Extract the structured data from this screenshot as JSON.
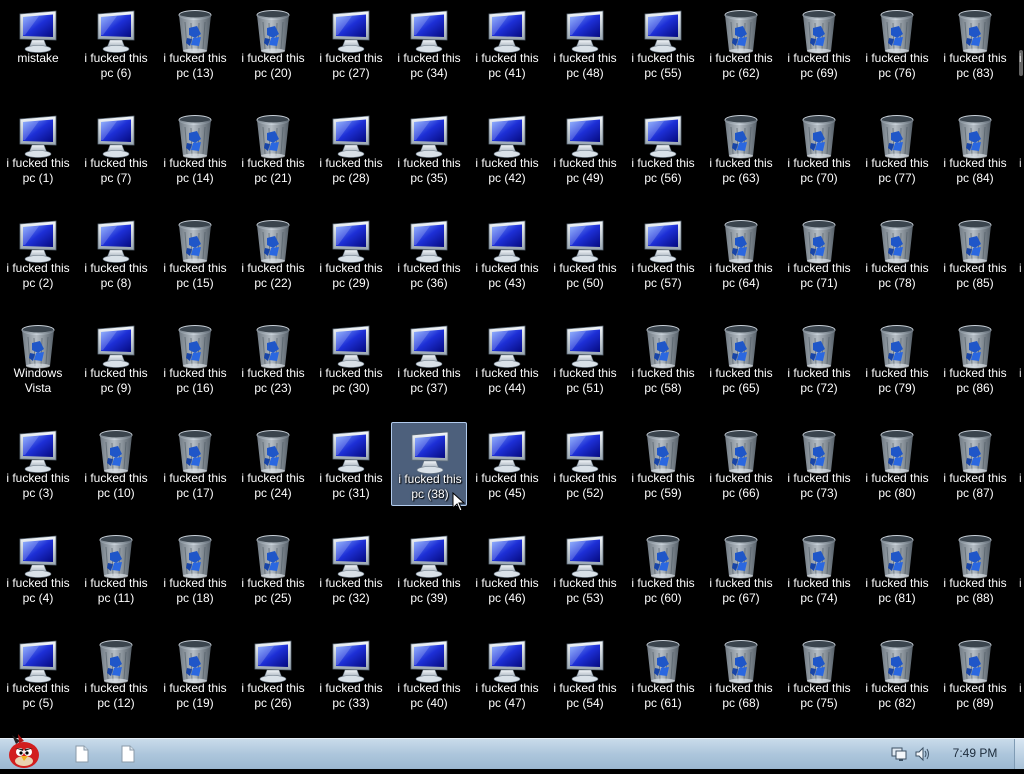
{
  "desktop": {
    "columns": [
      {
        "icons": [
          {
            "label": "mistake",
            "type": "computer"
          },
          {
            "label": "i fucked this pc (1)",
            "type": "computer"
          },
          {
            "label": "i fucked this pc (2)",
            "type": "computer"
          },
          {
            "label": "Windows Vista",
            "type": "recycle"
          },
          {
            "label": "i fucked this pc (3)",
            "type": "computer"
          },
          {
            "label": "i fucked this pc (4)",
            "type": "computer"
          },
          {
            "label": "i fucked this pc (5)",
            "type": "computer"
          }
        ]
      },
      {
        "icons": [
          {
            "label": "i fucked this pc (6)",
            "type": "computer"
          },
          {
            "label": "i fucked this pc (7)",
            "type": "computer"
          },
          {
            "label": "i fucked this pc (8)",
            "type": "computer"
          },
          {
            "label": "i fucked this pc (9)",
            "type": "computer"
          },
          {
            "label": "i fucked this pc (10)",
            "type": "recycle"
          },
          {
            "label": "i fucked this pc (11)",
            "type": "recycle"
          },
          {
            "label": "i fucked this pc (12)",
            "type": "recycle"
          }
        ]
      },
      {
        "icons": [
          {
            "label": "i fucked this pc (13)",
            "type": "recycle"
          },
          {
            "label": "i fucked this pc (14)",
            "type": "recycle"
          },
          {
            "label": "i fucked this pc (15)",
            "type": "recycle"
          },
          {
            "label": "i fucked this pc (16)",
            "type": "recycle"
          },
          {
            "label": "i fucked this pc (17)",
            "type": "recycle"
          },
          {
            "label": "i fucked this pc (18)",
            "type": "recycle"
          },
          {
            "label": "i fucked this pc (19)",
            "type": "recycle"
          }
        ]
      },
      {
        "icons": [
          {
            "label": "i fucked this pc (20)",
            "type": "recycle"
          },
          {
            "label": "i fucked this pc (21)",
            "type": "recycle"
          },
          {
            "label": "i fucked this pc (22)",
            "type": "recycle"
          },
          {
            "label": "i fucked this pc (23)",
            "type": "recycle"
          },
          {
            "label": "i fucked this pc (24)",
            "type": "recycle"
          },
          {
            "label": "i fucked this pc (25)",
            "type": "recycle"
          },
          {
            "label": "i fucked this pc (26)",
            "type": "computer"
          }
        ]
      },
      {
        "icons": [
          {
            "label": "i fucked this pc (27)",
            "type": "computer"
          },
          {
            "label": "i fucked this pc (28)",
            "type": "computer"
          },
          {
            "label": "i fucked this pc (29)",
            "type": "computer"
          },
          {
            "label": "i fucked this pc (30)",
            "type": "computer"
          },
          {
            "label": "i fucked this pc (31)",
            "type": "computer"
          },
          {
            "label": "i fucked this pc (32)",
            "type": "computer"
          },
          {
            "label": "i fucked this pc (33)",
            "type": "computer"
          }
        ]
      },
      {
        "icons": [
          {
            "label": "i fucked this pc (34)",
            "type": "computer"
          },
          {
            "label": "i fucked this pc (35)",
            "type": "computer"
          },
          {
            "label": "i fucked this pc (36)",
            "type": "computer"
          },
          {
            "label": "i fucked this pc (37)",
            "type": "computer"
          },
          {
            "label": "i fucked this pc (38)",
            "type": "computer",
            "selected": true
          },
          {
            "label": "i fucked this pc (39)",
            "type": "computer"
          },
          {
            "label": "i fucked this pc (40)",
            "type": "computer"
          }
        ]
      },
      {
        "icons": [
          {
            "label": "i fucked this pc (41)",
            "type": "computer"
          },
          {
            "label": "i fucked this pc (42)",
            "type": "computer"
          },
          {
            "label": "i fucked this pc (43)",
            "type": "computer"
          },
          {
            "label": "i fucked this pc (44)",
            "type": "computer"
          },
          {
            "label": "i fucked this pc (45)",
            "type": "computer"
          },
          {
            "label": "i fucked this pc (46)",
            "type": "computer"
          },
          {
            "label": "i fucked this pc (47)",
            "type": "computer"
          }
        ]
      },
      {
        "icons": [
          {
            "label": "i fucked this pc (48)",
            "type": "computer"
          },
          {
            "label": "i fucked this pc (49)",
            "type": "computer"
          },
          {
            "label": "i fucked this pc (50)",
            "type": "computer"
          },
          {
            "label": "i fucked this pc (51)",
            "type": "computer"
          },
          {
            "label": "i fucked this pc (52)",
            "type": "computer"
          },
          {
            "label": "i fucked this pc (53)",
            "type": "computer"
          },
          {
            "label": "i fucked this pc (54)",
            "type": "computer"
          }
        ]
      },
      {
        "icons": [
          {
            "label": "i fucked this pc (55)",
            "type": "computer"
          },
          {
            "label": "i fucked this pc (56)",
            "type": "computer"
          },
          {
            "label": "i fucked this pc (57)",
            "type": "computer"
          },
          {
            "label": "i fucked this pc (58)",
            "type": "recycle"
          },
          {
            "label": "i fucked this pc (59)",
            "type": "recycle"
          },
          {
            "label": "i fucked this pc (60)",
            "type": "recycle"
          },
          {
            "label": "i fucked this pc (61)",
            "type": "recycle"
          }
        ]
      },
      {
        "icons": [
          {
            "label": "i fucked this pc (62)",
            "type": "recycle"
          },
          {
            "label": "i fucked this pc (63)",
            "type": "recycle"
          },
          {
            "label": "i fucked this pc (64)",
            "type": "recycle"
          },
          {
            "label": "i fucked this pc (65)",
            "type": "recycle"
          },
          {
            "label": "i fucked this pc (66)",
            "type": "recycle"
          },
          {
            "label": "i fucked this pc (67)",
            "type": "recycle"
          },
          {
            "label": "i fucked this pc (68)",
            "type": "recycle"
          }
        ]
      },
      {
        "icons": [
          {
            "label": "i fucked this pc (69)",
            "type": "recycle"
          },
          {
            "label": "i fucked this pc (70)",
            "type": "recycle"
          },
          {
            "label": "i fucked this pc (71)",
            "type": "recycle"
          },
          {
            "label": "i fucked this pc (72)",
            "type": "recycle"
          },
          {
            "label": "i fucked this pc (73)",
            "type": "recycle"
          },
          {
            "label": "i fucked this pc (74)",
            "type": "recycle"
          },
          {
            "label": "i fucked this pc (75)",
            "type": "recycle"
          }
        ]
      },
      {
        "icons": [
          {
            "label": "i fucked this pc (76)",
            "type": "recycle"
          },
          {
            "label": "i fucked this pc (77)",
            "type": "recycle"
          },
          {
            "label": "i fucked this pc (78)",
            "type": "recycle"
          },
          {
            "label": "i fucked this pc (79)",
            "type": "recycle"
          },
          {
            "label": "i fucked this pc (80)",
            "type": "recycle"
          },
          {
            "label": "i fucked this pc (81)",
            "type": "recycle"
          },
          {
            "label": "i fucked this pc (82)",
            "type": "recycle"
          }
        ]
      },
      {
        "icons": [
          {
            "label": "i fucked this pc (83)",
            "type": "recycle"
          },
          {
            "label": "i fucked this pc (84)",
            "type": "recycle"
          },
          {
            "label": "i fucked this pc (85)",
            "type": "recycle"
          },
          {
            "label": "i fucked this pc (86)",
            "type": "recycle"
          },
          {
            "label": "i fucked this pc (87)",
            "type": "recycle"
          },
          {
            "label": "i fucked this pc (88)",
            "type": "recycle"
          },
          {
            "label": "i fucked this pc (89)",
            "type": "recycle"
          }
        ]
      }
    ],
    "cut_off_label": "i"
  },
  "taskbar": {
    "start_icon": "angry-bird-start-orb-icon",
    "pinned": [
      {
        "name": "document-icon"
      },
      {
        "name": "document-icon"
      }
    ],
    "tray": {
      "network_icon": "network-icon",
      "volume_icon": "volume-icon",
      "clock": "7:49 PM"
    }
  },
  "colors": {
    "desktop_bg": "#000000",
    "selection": "#8cafe1",
    "taskbar": "#adc6dc",
    "label_text": "#ffffff"
  }
}
